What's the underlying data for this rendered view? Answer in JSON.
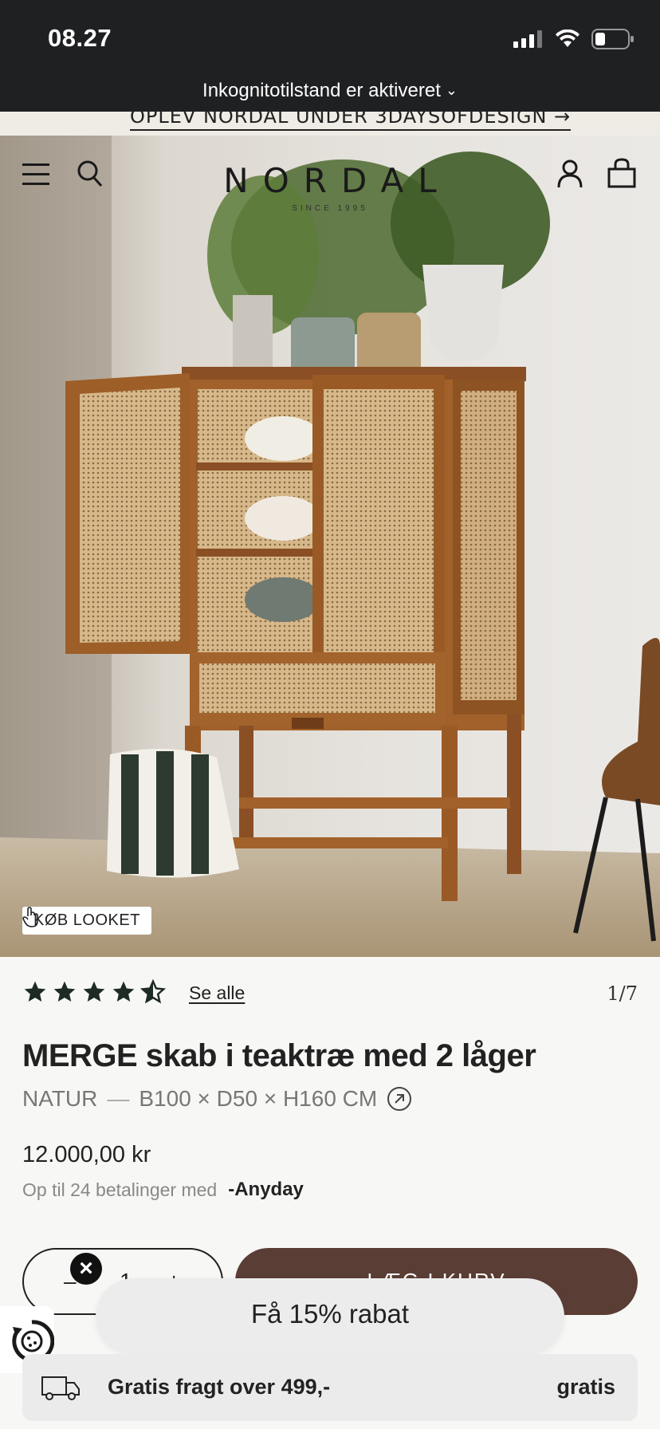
{
  "status_bar": {
    "time": "08.27",
    "incognito_text": "Inkognitotilstand er aktiveret"
  },
  "promo": {
    "link_text": "OPLEV NORDAL UNDER 3DAYSOFDESIGN →"
  },
  "header": {
    "logo": "NORDAL",
    "logo_subtitle": "SINCE 1995",
    "icons": [
      "menu-icon",
      "search-icon",
      "account-icon",
      "cart-icon"
    ]
  },
  "hero": {
    "shop_look_label": "KØB LOOKET"
  },
  "product": {
    "rating": 4.5,
    "rating_max": 5,
    "see_all_label": "Se alle",
    "image_counter": "1/7",
    "title": "MERGE skab i teaktræ med 2 låger",
    "variant_color": "NATUR",
    "variant_separator": "—",
    "variant_size": "B100 × D50 × H160 CM",
    "price": "12.000,00 kr",
    "installments_text": "Op til 24 betalinger med",
    "installments_provider": "-Anyday"
  },
  "actions": {
    "quantity_minus": "–",
    "quantity_value": "1",
    "quantity_plus": "+",
    "add_to_cart_label": "LÆG I KURV"
  },
  "popup": {
    "discount_label": "Få 15% rabat"
  },
  "shipping": {
    "text": "Gratis fragt over 499,-",
    "value": "gratis"
  },
  "colors": {
    "accent": "#5a3d35",
    "status_bar": "#1f2022"
  }
}
